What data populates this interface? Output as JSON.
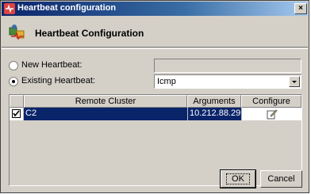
{
  "window": {
    "title": "Heartbeat configuration",
    "close_label": "×"
  },
  "header": {
    "title": "Heartbeat Configuration"
  },
  "options": {
    "new_label": "New Heartbeat:",
    "new_value": "",
    "existing_label": "Existing Heartbeat:",
    "existing_value": "Icmp",
    "selected": "existing"
  },
  "table": {
    "columns": [
      "Remote Cluster",
      "Arguments",
      "Configure"
    ],
    "rows": [
      {
        "checked": true,
        "cluster": "C2",
        "arguments": "10.212.88.29",
        "configure_icon": "edit-icon"
      }
    ]
  },
  "buttons": {
    "ok_label": "OK",
    "cancel_label": "Cancel"
  },
  "colors": {
    "selection": "#0a246a",
    "dialog_bg": "#d4d0c8"
  }
}
